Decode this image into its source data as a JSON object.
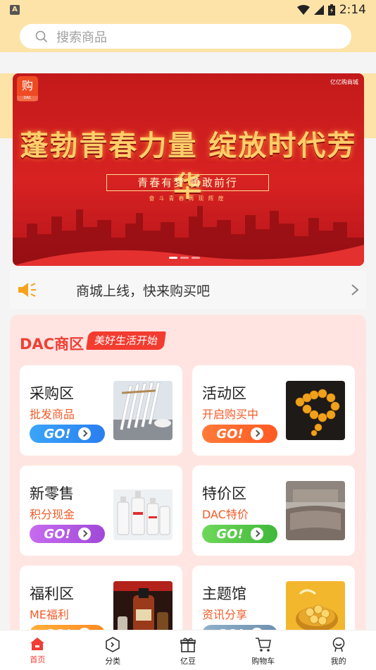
{
  "status_bar": {
    "time": "2:14",
    "notification": "A"
  },
  "search": {
    "placeholder": "搜索商品"
  },
  "banner": {
    "logo_char": "购",
    "logo_sub": "DAC",
    "brand": "亿亿购商城",
    "title": "蓬勃青春力量 绽放时代芳华",
    "subtitle": "青春有梦 勇敢前行",
    "tagline": "奋斗青春再现辉煌",
    "slides": 3,
    "active_slide": 1
  },
  "notice": {
    "text": "商城上线，快来购买吧"
  },
  "dac_section": {
    "title": "DAC商区",
    "tag": "美好生活开始",
    "go_label": "GO!",
    "cards": [
      {
        "title": "采购区",
        "subtitle": "批发商品",
        "go_color_start": "#3aa5f8",
        "go_color_end": "#2a7ef0",
        "image": "chopsticks-image"
      },
      {
        "title": "活动区",
        "subtitle": "开启购买中",
        "go_color_start": "#ff7a3a",
        "go_color_end": "#ff5a22",
        "image": "amber-beads-image"
      },
      {
        "title": "新零售",
        "subtitle": "积分现金",
        "go_color_start": "#c76bf0",
        "go_color_end": "#a049d8",
        "image": "cleaner-bottles-image"
      },
      {
        "title": "特价区",
        "subtitle": "DAC特价",
        "go_color_start": "#6fd85a",
        "go_color_end": "#3fb83a",
        "image": "bedding-image"
      },
      {
        "title": "福利区",
        "subtitle": "ME福利",
        "go_color_start": "#ffb03a",
        "go_color_end": "#ff8a22",
        "image": "cognac-image"
      },
      {
        "title": "主题馆",
        "subtitle": "资讯分享",
        "go_color_start": "#8fb0c8",
        "go_color_end": "#6f90b0",
        "image": "gold-coins-image"
      }
    ]
  },
  "bottom_nav": [
    {
      "label": "首页",
      "icon": "home-icon",
      "active": true
    },
    {
      "label": "分类",
      "icon": "category-icon",
      "active": false
    },
    {
      "label": "亿豆",
      "icon": "gift-icon",
      "active": false
    },
    {
      "label": "购物车",
      "icon": "cart-icon",
      "active": false
    },
    {
      "label": "我的",
      "icon": "profile-icon",
      "active": false
    }
  ],
  "colors": {
    "accent": "#f03e34",
    "header": "#fde3a8",
    "orange_text": "#f45b28"
  }
}
